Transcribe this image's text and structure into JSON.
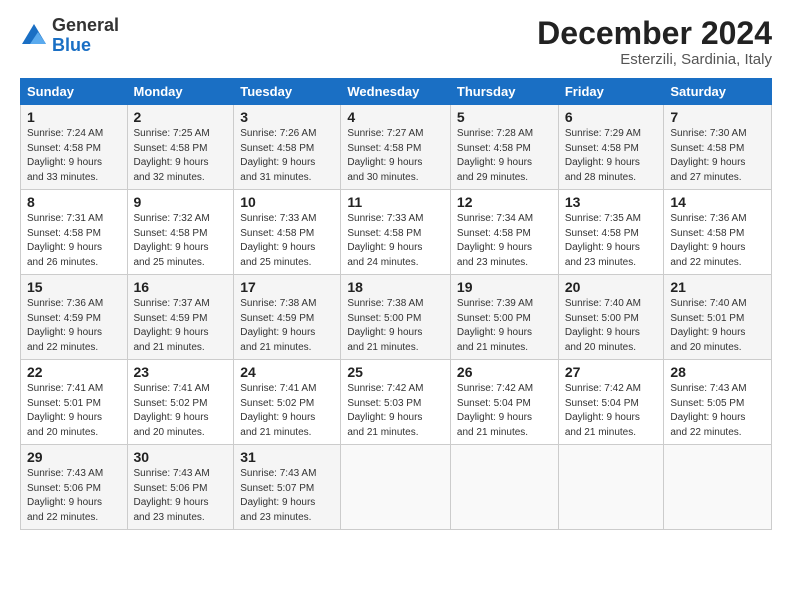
{
  "header": {
    "logo_line1": "General",
    "logo_line2": "Blue",
    "month": "December 2024",
    "location": "Esterzili, Sardinia, Italy"
  },
  "weekdays": [
    "Sunday",
    "Monday",
    "Tuesday",
    "Wednesday",
    "Thursday",
    "Friday",
    "Saturday"
  ],
  "weeks": [
    [
      {
        "day": "1",
        "info": "Sunrise: 7:24 AM\nSunset: 4:58 PM\nDaylight: 9 hours\nand 33 minutes."
      },
      {
        "day": "2",
        "info": "Sunrise: 7:25 AM\nSunset: 4:58 PM\nDaylight: 9 hours\nand 32 minutes."
      },
      {
        "day": "3",
        "info": "Sunrise: 7:26 AM\nSunset: 4:58 PM\nDaylight: 9 hours\nand 31 minutes."
      },
      {
        "day": "4",
        "info": "Sunrise: 7:27 AM\nSunset: 4:58 PM\nDaylight: 9 hours\nand 30 minutes."
      },
      {
        "day": "5",
        "info": "Sunrise: 7:28 AM\nSunset: 4:58 PM\nDaylight: 9 hours\nand 29 minutes."
      },
      {
        "day": "6",
        "info": "Sunrise: 7:29 AM\nSunset: 4:58 PM\nDaylight: 9 hours\nand 28 minutes."
      },
      {
        "day": "7",
        "info": "Sunrise: 7:30 AM\nSunset: 4:58 PM\nDaylight: 9 hours\nand 27 minutes."
      }
    ],
    [
      {
        "day": "8",
        "info": "Sunrise: 7:31 AM\nSunset: 4:58 PM\nDaylight: 9 hours\nand 26 minutes."
      },
      {
        "day": "9",
        "info": "Sunrise: 7:32 AM\nSunset: 4:58 PM\nDaylight: 9 hours\nand 25 minutes."
      },
      {
        "day": "10",
        "info": "Sunrise: 7:33 AM\nSunset: 4:58 PM\nDaylight: 9 hours\nand 25 minutes."
      },
      {
        "day": "11",
        "info": "Sunrise: 7:33 AM\nSunset: 4:58 PM\nDaylight: 9 hours\nand 24 minutes."
      },
      {
        "day": "12",
        "info": "Sunrise: 7:34 AM\nSunset: 4:58 PM\nDaylight: 9 hours\nand 23 minutes."
      },
      {
        "day": "13",
        "info": "Sunrise: 7:35 AM\nSunset: 4:58 PM\nDaylight: 9 hours\nand 23 minutes."
      },
      {
        "day": "14",
        "info": "Sunrise: 7:36 AM\nSunset: 4:58 PM\nDaylight: 9 hours\nand 22 minutes."
      }
    ],
    [
      {
        "day": "15",
        "info": "Sunrise: 7:36 AM\nSunset: 4:59 PM\nDaylight: 9 hours\nand 22 minutes."
      },
      {
        "day": "16",
        "info": "Sunrise: 7:37 AM\nSunset: 4:59 PM\nDaylight: 9 hours\nand 21 minutes."
      },
      {
        "day": "17",
        "info": "Sunrise: 7:38 AM\nSunset: 4:59 PM\nDaylight: 9 hours\nand 21 minutes."
      },
      {
        "day": "18",
        "info": "Sunrise: 7:38 AM\nSunset: 5:00 PM\nDaylight: 9 hours\nand 21 minutes."
      },
      {
        "day": "19",
        "info": "Sunrise: 7:39 AM\nSunset: 5:00 PM\nDaylight: 9 hours\nand 21 minutes."
      },
      {
        "day": "20",
        "info": "Sunrise: 7:40 AM\nSunset: 5:00 PM\nDaylight: 9 hours\nand 20 minutes."
      },
      {
        "day": "21",
        "info": "Sunrise: 7:40 AM\nSunset: 5:01 PM\nDaylight: 9 hours\nand 20 minutes."
      }
    ],
    [
      {
        "day": "22",
        "info": "Sunrise: 7:41 AM\nSunset: 5:01 PM\nDaylight: 9 hours\nand 20 minutes."
      },
      {
        "day": "23",
        "info": "Sunrise: 7:41 AM\nSunset: 5:02 PM\nDaylight: 9 hours\nand 20 minutes."
      },
      {
        "day": "24",
        "info": "Sunrise: 7:41 AM\nSunset: 5:02 PM\nDaylight: 9 hours\nand 21 minutes."
      },
      {
        "day": "25",
        "info": "Sunrise: 7:42 AM\nSunset: 5:03 PM\nDaylight: 9 hours\nand 21 minutes."
      },
      {
        "day": "26",
        "info": "Sunrise: 7:42 AM\nSunset: 5:04 PM\nDaylight: 9 hours\nand 21 minutes."
      },
      {
        "day": "27",
        "info": "Sunrise: 7:42 AM\nSunset: 5:04 PM\nDaylight: 9 hours\nand 21 minutes."
      },
      {
        "day": "28",
        "info": "Sunrise: 7:43 AM\nSunset: 5:05 PM\nDaylight: 9 hours\nand 22 minutes."
      }
    ],
    [
      {
        "day": "29",
        "info": "Sunrise: 7:43 AM\nSunset: 5:06 PM\nDaylight: 9 hours\nand 22 minutes."
      },
      {
        "day": "30",
        "info": "Sunrise: 7:43 AM\nSunset: 5:06 PM\nDaylight: 9 hours\nand 23 minutes."
      },
      {
        "day": "31",
        "info": "Sunrise: 7:43 AM\nSunset: 5:07 PM\nDaylight: 9 hours\nand 23 minutes."
      },
      null,
      null,
      null,
      null
    ]
  ]
}
